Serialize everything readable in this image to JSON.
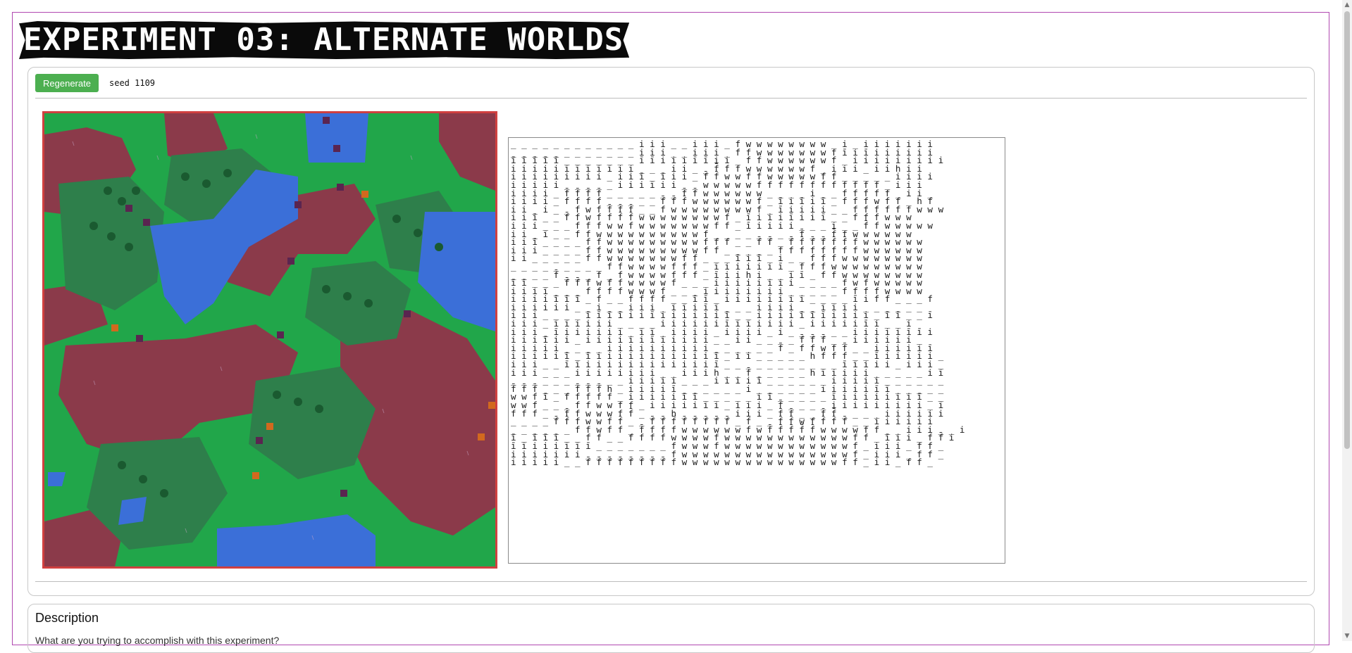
{
  "page": {
    "title": "EXPERIMENT 03: ALTERNATE WORLDS"
  },
  "controls": {
    "regenerate_label": "Regenerate",
    "seed_text": "seed 1109"
  },
  "description": {
    "heading": "Description",
    "text": "What are you trying to accomplish with this experiment?"
  },
  "map": {
    "colors": {
      "grass": "#21a64a",
      "forest": "#2e7f4b",
      "dirt": "#8b3a4a",
      "water": "#3b6fd8",
      "border": "#d04040"
    }
  },
  "ascii_rows": [
    "_ _ _ _ _ _ _ _ _ _ _ _ i i i _ _ i i i _ f w w w w w w w w _ i _ i i i i i i i",
    "_ _ _ _ _ _ _ _ _ _ _ _ i i i _ _ i i i _ f f w w w w w w w f ī i ī i i i i i i",
    "ī ī ī ī ī _ _ _ _ _ _ _ ī ī i i i ī ī i i _ f f w w w w w w f _ i i i i i i i i i",
    "i i i i i ī ī ī ī ī i i _ _ _ i i _ _ f̄ f f w w w w w w f _ i i i _ i i h i i",
    "i i i i i i i i i _ i i ī _ ī i i _ f̄ f̄ w w f f w w w w w f f̄ _ _ _ _ _ i i i i",
    "i i i i i _ _ _ _ _ i i i ī i i _ _ w w w w w f f f f f f f f f f f f _ i i i",
    "i i i i _ f̄ f̄ f̄ f̄ _ _ _ _ _ _ _ f̄ f̄ w w w w w w _ _ _ _ i _ _ f f f f f _ i i _",
    "i i i i _ f f f f _ _ _ _ _ f̄ f̄ f̄ w w w w w w f _ ī i ī i ī _ f f f w f f _ h f",
    "i i _ i _ _ f w f f̄ f̄ f̄ _ _ f w w w w w w w w f _ ī i i i i _ _ f f f f f f w w w",
    "i i ī _ _ f̄ f w f f f̄ f̄ w w w w w w w w f _ ī i i i ī i i ī _ _ f f f w w w",
    "i i i _ _ _ f f f w w f w w w w w w w f f _ ī i i i i _ _ _ i _ _ f̄ f w w w w w",
    "i i _ ī _ _ f f w w w w w w w w w w f _ _ _ _ _ _ _ _ f̄ _ _ f̄ f w w w w w w",
    "i i ī _ _ _ _ f f w w w w w w w w w f f f _ _ f̄ f̄ _ f̄ f̄ f̄ f̄ f̄ f̄ f w w w w w w",
    "i i i _ _ _ _ f f w w w w w w w w w f f _ _ _ _ _ f f f f f f f f w w w w w w",
    "i i _ _ _ _ _ f f w w w w w w w f f _ _ _ ī i ī _ i _ _ f f f w w w w w w w w",
    "_ _ _ _ _ _ _ _ _ f f w w w w f f f _ ī i i i i i ī _ f f f w w w w w w w w w",
    "_ _ _ _ f̄ _ _ _ f _ f w w w w f f f _ ī i i h i _ _ i ī _ f f w w w w w w w w",
    "ī ī _ _ _ f̄ f̄ f w f f w w w w f _ _ _ i i i i i i i i _ _ _ _ f w f w w w w w",
    "i i i ī _ _ _ f f f f w w w f _ _ _ i i i i i i i i _ _ _ _ _ f f f f w w w w",
    "i i i i ī ī ī _ f _ _ f f f f _ _ ī ī _ i i i i i i i i _ _ _ _ ī i f f _ _ _ f",
    "i i i i i i _ _ i _ _ i i i _ ī ī i ī ī _ _ _ i i i i _ _ ī ī i i _ _ _ _ _ _",
    "i i i _ _ _ _ ī ī ī ī i i ī i i i i i i ī _ _ i i i i ī ī ī i i i i _ ī ī _ _ ī",
    "i i i _ ī ī i i i i _ _ _ _ i i i i i i ī ī ī i i i i _ i i i i i ī i _ _ i",
    "i i i _ ī i i i i i i _ ī ī _ i i i i _ i i i i _ i _ _ _ _ _ _ i i i i i ī ī i",
    "i i i ī i i _ i i i i i i ī i i i i i _ _ i i _ _ _ _ f̄ f̄ f̄ _ _ i i i i i i _",
    "i i i i i _ _ _ _ i i i i i i i i i i _ _ _ _ _ _ f̄ _ f f w f f̄ _ _ i i i i i ī",
    "i i i i i ī _ ī i i i i i i i i i i i ī _ i i _ _ _ _ _ h f f f _ _ ī i i i i i _",
    "i i i _ _ ī ī i i i i i i i i i i i i ī _ _ _ _ _ _ _ _ _ _ _ ī ī i i i _ i i i _",
    "i i i _ _ _ i i i i i i i i _ _ i i i h _ _ f̄ _ _ _ _ _ h ī i i i i _ _ _ _ _ i ī",
    "_ _ _ _ _ _ _ _ _ _ _ i i i i i _ _ _ i i i i ī _ _ _ _ _ _ i i i i i _ _ _ _ _ _",
    "f̄ f̄ f̄ _ _ _ f̄ f̄ f̄ h _ i i i i ī _ _ _ _ _ _ i _ _ _ _ _ _ i i i i i ī ī _ _ _ _ _",
    "w w f ī _ f f f f f _ i i i i i ī ī _ _ _ _ _ i ī _ _ _ _ _ ī i i i i i i i ī _ _",
    "w w f _ _ _ f f w w f f _ i i i i i ī i _ i i i _ f̄ _ _ _ _ i i i i i i i i i _ ī",
    "f f f _ _ f̄ f w w w f f̄ _ _ _ h _ _ _ _ _ i i i _ f̄ f̄ _ _ f̄ f̄ _ _ _ _ i i i i i i",
    "_ _ _ _ f̄ f̄ f w w f f̄ _ _ f̄ f̄ f̄ f̄ f̄ f̄ f̄ f̄ _ f̄ _ _ f̄ f̄ w f f̄ f̄ f̄ _ _ i i i i i i",
    "_ _ _ _ _ _ f f w f f _ f̄ f f f w w w w w w f w f̄ f̄ f̄ f̄ f̄ w w w w f f _ _ i i i _ _ i",
    "ī _ ī ī ī _ _ f f _ _ f f f f w w w w f w w w w w w w w w w w w f f _ ī i i _ f̄ f̄ i",
    "ī ī i i i ī ī ī _ _ _ _ _ _ _ f w w w f w w w w w w w w w w w w f _ i i i _ f f _",
    "i i i i i i i _ _ _ _ _ _ _ _ f w w w w w w w w w w w w w w w w f _ i i i _ f f _",
    "i i i i i _ _ f̄ f̄ f̄ f̄ f̄ f̄ f̄ f̄ f w w w w w w w w w w w w w w w f f _ i i _ f f _"
  ]
}
